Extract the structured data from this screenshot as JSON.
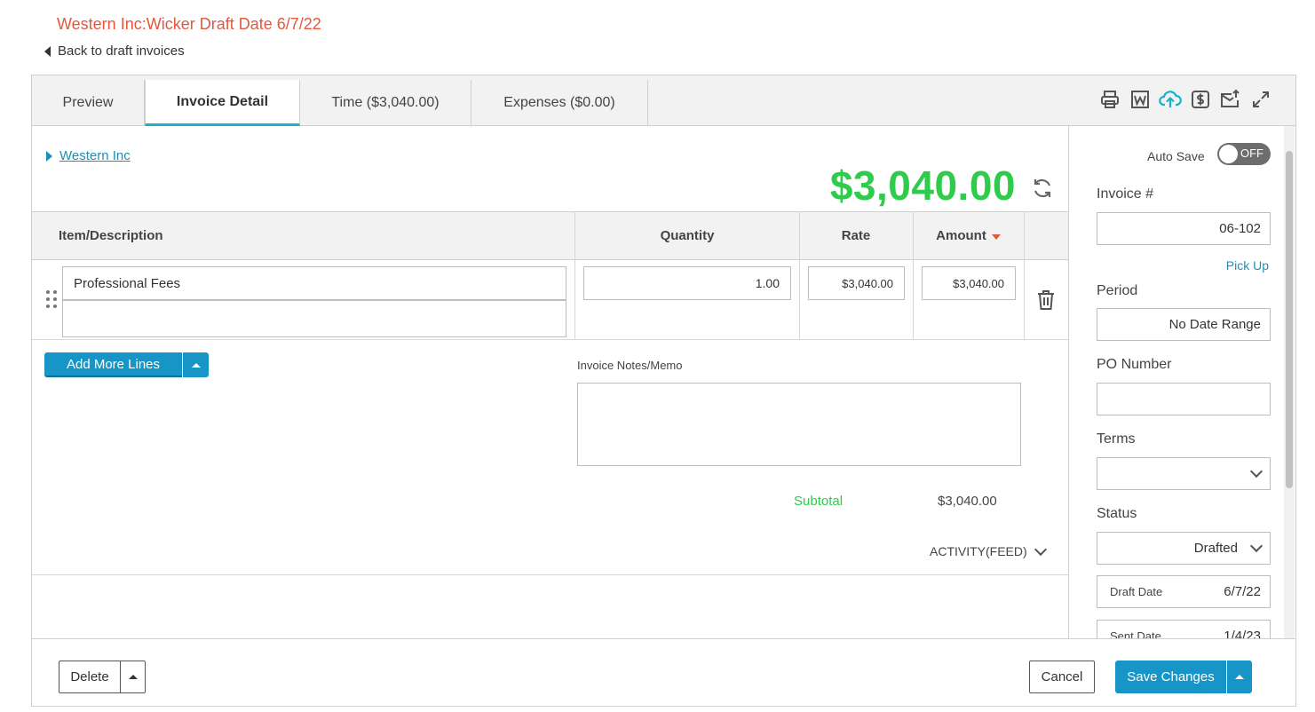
{
  "page": {
    "title": "Western Inc:Wicker Draft Date 6/7/22",
    "back_link": "Back to draft invoices"
  },
  "tabs": [
    {
      "label": "Preview"
    },
    {
      "label": "Invoice Detail"
    },
    {
      "label": "Time ($3,040.00)"
    },
    {
      "label": "Expenses ($0.00)"
    }
  ],
  "toolbar_icons": [
    "print-icon",
    "word-icon",
    "cloud-upload-icon",
    "dollar-icon",
    "email-send-icon",
    "expand-icon"
  ],
  "client": {
    "name": "Western Inc"
  },
  "invoice": {
    "total": "$3,040.00"
  },
  "table": {
    "headers": {
      "item": "Item/Description",
      "quantity": "Quantity",
      "rate": "Rate",
      "amount": "Amount"
    },
    "rows": [
      {
        "item": "Professional Fees",
        "description": "",
        "quantity": "1.00",
        "rate": "$3,040.00",
        "amount": "$3,040.00"
      }
    ]
  },
  "add_lines": {
    "label": "Add More Lines"
  },
  "memo": {
    "label": "Invoice Notes/Memo",
    "value": ""
  },
  "subtotal": {
    "label": "Subtotal",
    "value": "$3,040.00"
  },
  "activity": {
    "label": "ACTIVITY(FEED)"
  },
  "sidebar": {
    "auto_save_label": "Auto Save",
    "auto_save_state": "OFF",
    "invoice_number_label": "Invoice #",
    "invoice_number": "06-102",
    "pick_up": "Pick Up",
    "period_label": "Period",
    "period_value": "No Date Range",
    "po_label": "PO Number",
    "po_value": "",
    "terms_label": "Terms",
    "terms_value": "",
    "status_label": "Status",
    "status_value": "Drafted",
    "draft_date_label": "Draft Date",
    "draft_date": "6/7/22",
    "sent_date_label": "Sent Date",
    "sent_date": "1/4/23"
  },
  "footer": {
    "delete": "Delete",
    "cancel": "Cancel",
    "save": "Save Changes"
  },
  "colors": {
    "title": "#e4573d",
    "total": "#2ecc4a",
    "primary": "#1795c6",
    "link": "#1e8fb5",
    "active_tab_underline": "#1ab2c8"
  }
}
